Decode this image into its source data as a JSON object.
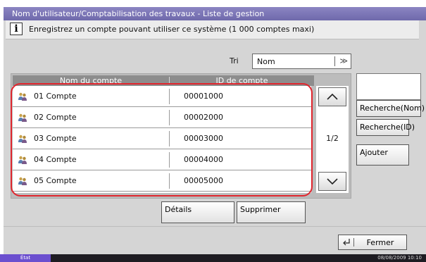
{
  "title": "Nom d'utilisateur/Comptabilisation des travaux - Liste de gestion",
  "info": "Enregistrez un compte pouvant utiliser ce système (1 000 comptes maxi)",
  "info_icon": "i",
  "sort": {
    "label": "Tri",
    "value": "Nom",
    "arrow": "≫"
  },
  "table": {
    "columns": [
      "Nom du compte",
      "ID de compte"
    ],
    "rows": [
      {
        "name": "01  Compte",
        "id": "00001000"
      },
      {
        "name": "02  Compte",
        "id": "00002000"
      },
      {
        "name": "03  Compte",
        "id": "00003000"
      },
      {
        "name": "04  Compte",
        "id": "00004000"
      },
      {
        "name": "05  Compte",
        "id": "00005000"
      }
    ]
  },
  "pager": {
    "page": "1/2"
  },
  "side_buttons": {
    "search_name": "Recherche(Nom)",
    "search_id": "Recherche(ID)",
    "add": "Ajouter"
  },
  "action_buttons": {
    "details": "Détails",
    "delete": "Supprimer"
  },
  "footer": {
    "close": "Fermer"
  },
  "status": {
    "label": "État",
    "datetime": "08/08/2009   10:10"
  },
  "colors": {
    "title_bar": "#7b76b9",
    "highlight_ring": "#e0262e",
    "status_accent": "#6b4fcf"
  }
}
